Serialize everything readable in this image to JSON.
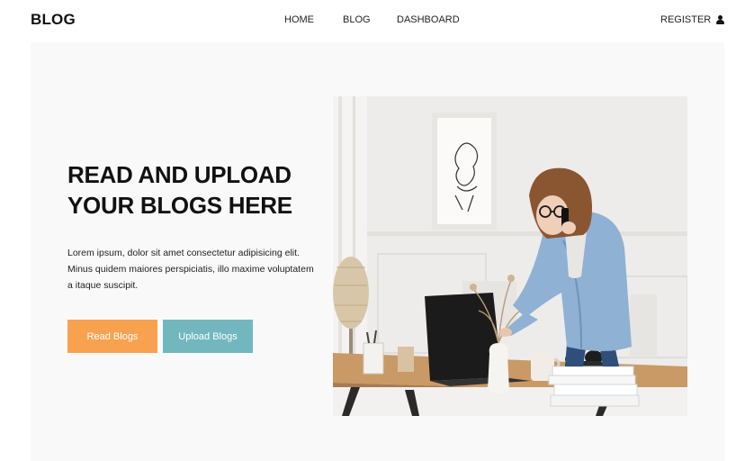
{
  "nav": {
    "logo": "BLOG",
    "links": [
      "HOME",
      "BLOG",
      "DASHBOARD"
    ],
    "register": "REGISTER"
  },
  "hero": {
    "headline": "READ AND UPLOAD YOUR BLOGS HERE",
    "description": "Lorem ipsum, dolor sit amet consectetur adipisicing elit. Minus quidem maiores perspiciatis, illo maxime voluptatem a itaque suscipit.",
    "read_button": "Read Blogs",
    "upload_button": "Upload Blogs"
  },
  "colors": {
    "read_button": "#f8a24f",
    "upload_button": "#72b7be",
    "hero_background": "#f9f9f9"
  },
  "icons": {
    "register": "user-icon"
  }
}
